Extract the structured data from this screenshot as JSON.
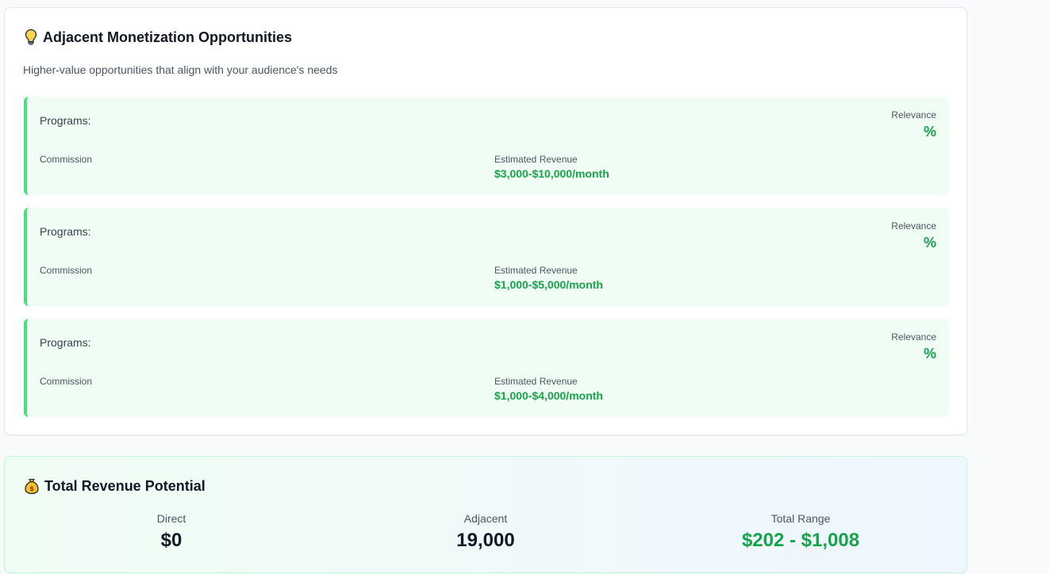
{
  "adjacent": {
    "title": "Adjacent Monetization Opportunities",
    "subtitle": "Higher-value opportunities that align with your audience's needs",
    "icon": "lightbulb-icon",
    "items": [
      {
        "programs_label": "Programs:",
        "relevance_label": "Relevance",
        "relevance_value": "%",
        "commission_label": "Commission",
        "revenue_label": "Estimated Revenue",
        "revenue_value": "$3,000-$10,000/month"
      },
      {
        "programs_label": "Programs:",
        "relevance_label": "Relevance",
        "relevance_value": "%",
        "commission_label": "Commission",
        "revenue_label": "Estimated Revenue",
        "revenue_value": "$1,000-$5,000/month"
      },
      {
        "programs_label": "Programs:",
        "relevance_label": "Relevance",
        "relevance_value": "%",
        "commission_label": "Commission",
        "revenue_label": "Estimated Revenue",
        "revenue_value": "$1,000-$4,000/month"
      }
    ]
  },
  "total": {
    "title": "Total Revenue Potential",
    "icon": "money-bag-icon",
    "direct_label": "Direct",
    "direct_value": "$0",
    "adjacent_label": "Adjacent",
    "adjacent_value": "19,000",
    "range_label": "Total Range",
    "range_value": "$202 - $1,008"
  },
  "colors": {
    "accent_green": "#16a34a",
    "card_bg_green": "#f0fdf4",
    "border_green": "#4ade80"
  }
}
